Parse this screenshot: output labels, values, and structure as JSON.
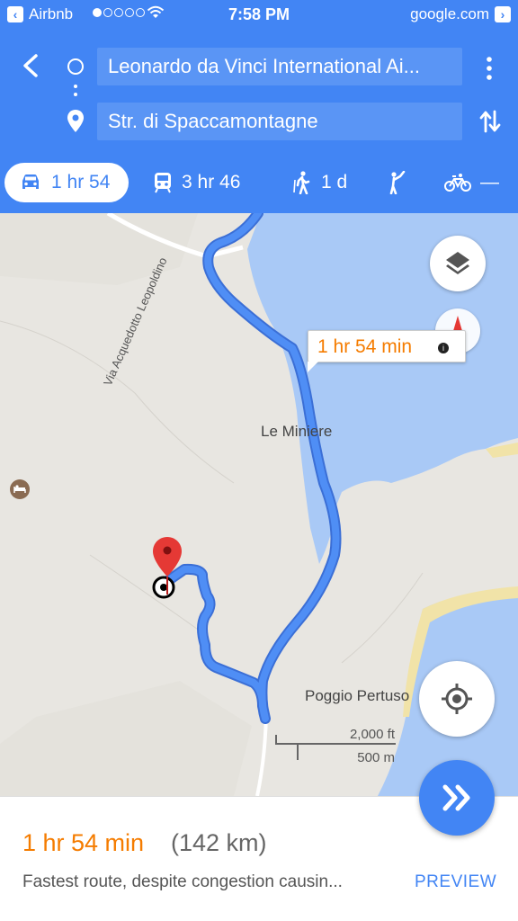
{
  "status_bar": {
    "back_app": "Airbnb",
    "time": "7:58 PM",
    "site": "google.com"
  },
  "directions": {
    "from": "Leonardo da Vinci International Ai...",
    "to": "Str. di Spaccamontagne"
  },
  "modes": [
    {
      "icon": "car-icon",
      "label": "1 hr 54",
      "active": true
    },
    {
      "icon": "train-icon",
      "label": "3 hr 46"
    },
    {
      "icon": "walk-icon",
      "label": "1 d"
    },
    {
      "icon": "ride-hail-icon",
      "label": ""
    },
    {
      "icon": "bike-icon",
      "label": "—"
    }
  ],
  "map": {
    "eta_callout": "1 hr 54 min",
    "labels": {
      "le_miniere": "Le Miniere",
      "poggio_pertuso": "Poggio Pertuso",
      "road": "Via Acquedotto Leopoldino"
    },
    "scale": {
      "imperial": "2,000 ft",
      "metric": "500 m"
    }
  },
  "route": {
    "duration": "1 hr 54 min",
    "distance": "(142 km)",
    "description": "Fastest route, despite congestion causin...",
    "preview_label": "PREVIEW"
  },
  "colors": {
    "primary": "#4285f4",
    "eta": "#f57c00",
    "water": "#a9c9f6",
    "land": "#e8e6e1",
    "route": "#4a89f3"
  }
}
